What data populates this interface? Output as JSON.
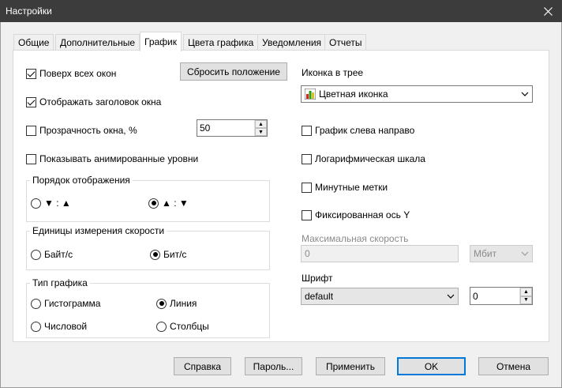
{
  "window": {
    "title": "Настройки"
  },
  "tabs": [
    {
      "label": "Общие"
    },
    {
      "label": "Дополнительные"
    },
    {
      "label": "График"
    },
    {
      "label": "Цвета графика"
    },
    {
      "label": "Уведомления"
    },
    {
      "label": "Отчеты"
    }
  ],
  "left": {
    "always_on_top": {
      "label": "Поверх всех окон",
      "checked": true
    },
    "show_title": {
      "label": "Отображать заголовок окна",
      "checked": true
    },
    "transparency": {
      "label": "Прозрачность окна, %",
      "checked": false,
      "value": "50"
    },
    "animated_levels": {
      "label": "Показывать анимированные уровни",
      "checked": false
    },
    "reset_position_label": "Сбросить положение",
    "display_order": {
      "legend": "Порядок отображения",
      "option1": "▼ : ▲",
      "option2": "▲ : ▼",
      "selected": 2
    },
    "speed_units": {
      "legend": "Единицы измерения скорости",
      "option1": "Байт/с",
      "option2": "Бит/с",
      "selected": 2
    },
    "graph_type": {
      "legend": "Тип графика",
      "histogram": "Гистограмма",
      "line": "Линия",
      "numeric": "Числовой",
      "bars": "Столбцы",
      "selected": "line"
    }
  },
  "right": {
    "tray_icon_label": "Иконка в трее",
    "tray_icon_value": "Цветная иконка",
    "left_to_right": {
      "label": "График слева направо",
      "checked": false
    },
    "log_scale": {
      "label": "Логарифмическая шкала",
      "checked": false
    },
    "minute_marks": {
      "label": "Минутные метки",
      "checked": false
    },
    "fixed_y": {
      "label": "Фиксированная ось Y",
      "checked": false
    },
    "max_speed_label": "Максимальная скорость",
    "max_speed_value": "0",
    "max_speed_unit": "Мбит",
    "font_label": "Шрифт",
    "font_value": "default",
    "font_size": "0"
  },
  "buttons": {
    "help": "Справка",
    "password": "Пароль...",
    "apply": "Применить",
    "ok": "OK",
    "cancel": "Отмена"
  },
  "colors": {
    "titlebar": "#3c3c3c",
    "accent": "#0078d7"
  }
}
